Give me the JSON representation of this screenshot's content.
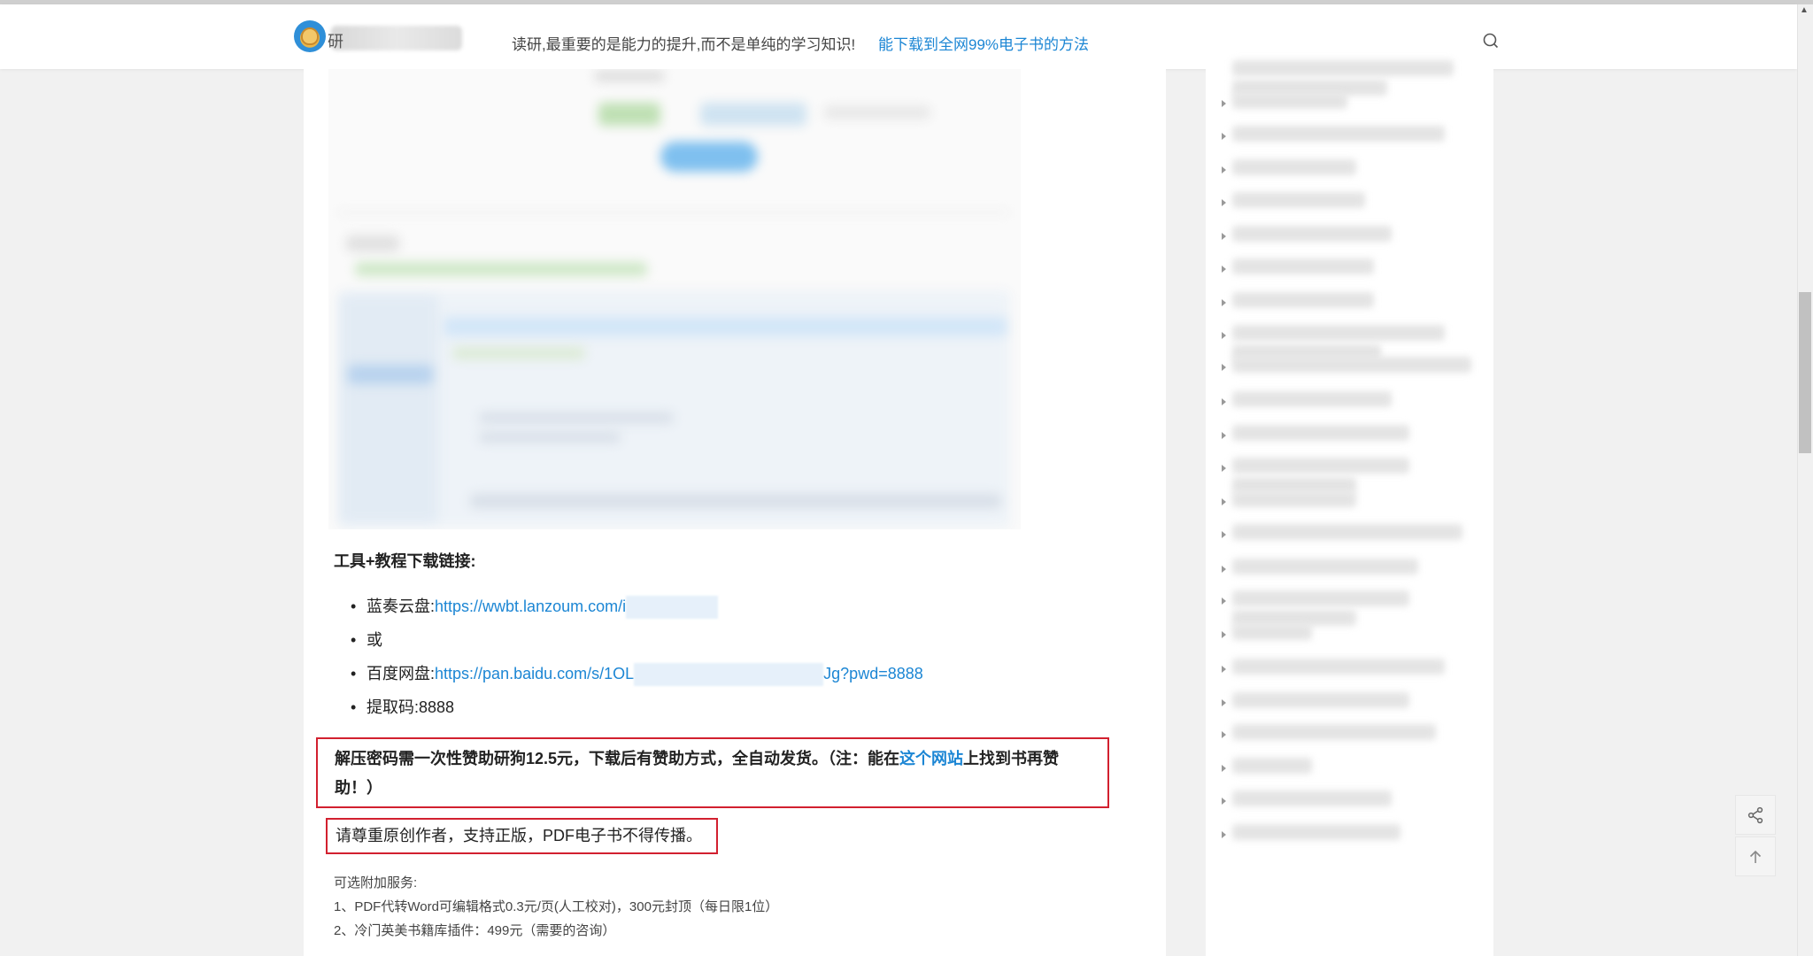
{
  "header": {
    "slogan": "读研,最重要的是能力的提升,而不是单纯的学习知识!",
    "top_link": "能下载到全网99%电子书的方法",
    "logo_letter": "研"
  },
  "article": {
    "section_title": "工具+教程下载链接:",
    "links": [
      {
        "label": "蓝奏云盘:",
        "url_prefix": "https://wwbt.lanzoum.com/i",
        "url_suffix": ""
      },
      {
        "label": "或"
      },
      {
        "label": "百度网盘:",
        "url_prefix": "https://pan.baidu.com/s/1OL",
        "url_suffix": "Jg?pwd=8888"
      },
      {
        "label": "提取码:",
        "value": "8888"
      }
    ],
    "notice_part1": "解压密码需一次性赞助研狗12.5元，下载后有赞助方式，全自动发货。（注：能在",
    "notice_link": "这个网站",
    "notice_part2": "上找到书再赞助！）",
    "copyright": "请尊重原创作者，支持正版，PDF电子书不得传播。",
    "extra_title": "可选附加服务:",
    "extra_1": "1、PDF代转Word可编辑格式0.3元/页(人工校对)，300元封顶（每日限1位）",
    "extra_2": "2、冷门英美书籍库插件：499元（需要的咨询）"
  },
  "sidebar": {
    "item_count": 24
  },
  "icons": {
    "search": "search-icon",
    "share": "share-icon",
    "back_to_top": "arrow-up-icon"
  },
  "colors": {
    "link": "#1c86d4",
    "notice_border": "#d2202f"
  }
}
